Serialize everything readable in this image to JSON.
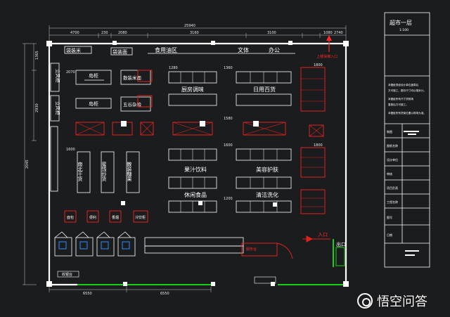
{
  "dimensions": {
    "total_width": "25940",
    "top_segments": [
      "4700",
      "230",
      "2080",
      "3160",
      "3100",
      "1080",
      "2740"
    ],
    "left_height": "2045",
    "left_segments": [
      "1365",
      "2930"
    ],
    "bottom_left": "6550",
    "bottom_right": "6550",
    "aisle_1": "1280",
    "aisle_2": "1360",
    "aisle_3": "1580",
    "aisle_4": "1600",
    "aisle_5": "1200",
    "right_1": "1800",
    "right_2": "1800",
    "misc_1": "2070",
    "misc_2": "1600"
  },
  "top_labels": {
    "bag_area_left": "袋装米",
    "bag_area_mid": "袋装面",
    "cooking_oil": "食用油区",
    "stationery": "文体",
    "office": "办公"
  },
  "left_labels": {
    "cold_1": "立风柜",
    "cold_2": "立风柜"
  },
  "fixtures": {
    "island_1": "岛柜",
    "island_2": "岛柜",
    "bagged_rice": "散装米面",
    "grains": "五谷杂粮",
    "dried_goods": "南北干货",
    "candied": "蜜饯炒货",
    "bulk_candy": "散装糖果",
    "bread": "面包",
    "cigarettes": "香烟",
    "snack_1": "便利",
    "drinks_cold": "冷饮柜",
    "checkout": "收银台",
    "service": "服务台"
  },
  "sections": {
    "kitchen": "厨房调味",
    "daily": "日用百货",
    "juice": "果汁饮料",
    "beauty": "美容护肤",
    "snacks": "休闲食品",
    "cleaning": "清洁洗化"
  },
  "entrance": {
    "in_label": "入口",
    "out_label": "出口",
    "arrow_text": "上楼扶梯入口"
  },
  "title_block": {
    "title": "超市一层",
    "scale": "1:100",
    "notes": [
      "本图纸须经设计单位盖章后",
      "方可施工，图中尺寸均以毫米计。",
      "本图纸所有尺寸须现场",
      "复核后方可施工。",
      "本图纸所有货架位置以现场为准。"
    ],
    "rows": [
      "制图",
      "图纸名称",
      "设计单位",
      "审核",
      "项目负责",
      "工程名称",
      "图号",
      "日期"
    ]
  },
  "watermark": "悟空问答",
  "colors": {
    "background": "#1b1c1e",
    "walls": "#ffffff",
    "shelves": "#ffffff",
    "red_fixtures": "#e02020",
    "green_glass": "#18d018",
    "dimension_lines": "#c8c8c8"
  }
}
